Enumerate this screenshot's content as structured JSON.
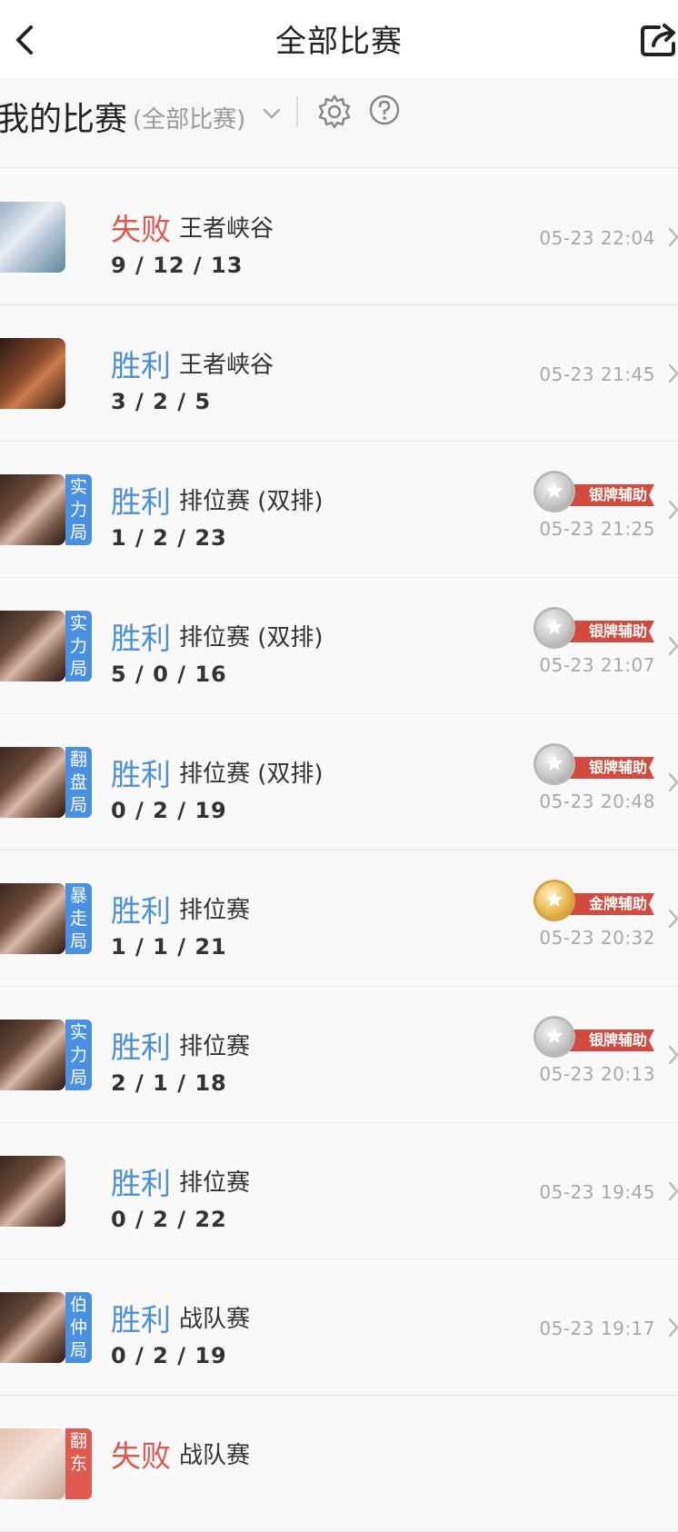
{
  "header": {
    "title": "全部比赛"
  },
  "filter": {
    "title": "我的比赛",
    "subtitle": "(全部比赛)"
  },
  "matches": [
    {
      "result": "失败",
      "result_type": "lose",
      "mode": "王者峡谷",
      "kda": "9 / 12 / 13",
      "time": "05-23 22:04",
      "tag": "",
      "badge": "",
      "avatar": "female2"
    },
    {
      "result": "胜利",
      "result_type": "win",
      "mode": "王者峡谷",
      "kda": "3 / 2 / 5",
      "time": "05-23 21:45",
      "tag": "",
      "badge": "",
      "avatar": "male"
    },
    {
      "result": "胜利",
      "result_type": "win",
      "mode": "排位赛 (双排)",
      "kda": "1 / 2 / 23",
      "time": "05-23 21:25",
      "tag": "实力局",
      "badge": "银牌辅助",
      "avatar": "female"
    },
    {
      "result": "胜利",
      "result_type": "win",
      "mode": "排位赛 (双排)",
      "kda": "5 / 0 / 16",
      "time": "05-23 21:07",
      "tag": "实力局",
      "badge": "银牌辅助",
      "avatar": "female"
    },
    {
      "result": "胜利",
      "result_type": "win",
      "mode": "排位赛 (双排)",
      "kda": "0 / 2 / 19",
      "time": "05-23 20:48",
      "tag": "翻盘局",
      "badge": "银牌辅助",
      "avatar": "female"
    },
    {
      "result": "胜利",
      "result_type": "win",
      "mode": "排位赛",
      "kda": "1 / 1 / 21",
      "time": "05-23 20:32",
      "tag": "暴走局",
      "badge": "金牌辅助",
      "avatar": "female"
    },
    {
      "result": "胜利",
      "result_type": "win",
      "mode": "排位赛",
      "kda": "2 / 1 / 18",
      "time": "05-23 20:13",
      "tag": "实力局",
      "badge": "银牌辅助",
      "avatar": "female"
    },
    {
      "result": "胜利",
      "result_type": "win",
      "mode": "排位赛",
      "kda": "0 / 2 / 22",
      "time": "05-23 19:45",
      "tag": "",
      "badge": "",
      "avatar": "female"
    },
    {
      "result": "胜利",
      "result_type": "win",
      "mode": "战队赛",
      "kda": "0 / 2 / 19",
      "time": "05-23 19:17",
      "tag": "伯仲局",
      "badge": "",
      "avatar": "female"
    },
    {
      "result": "失败",
      "result_type": "lose",
      "mode": "战队赛",
      "kda": "",
      "time": "",
      "tag": "翻东",
      "badge": "",
      "avatar": "female3"
    }
  ]
}
